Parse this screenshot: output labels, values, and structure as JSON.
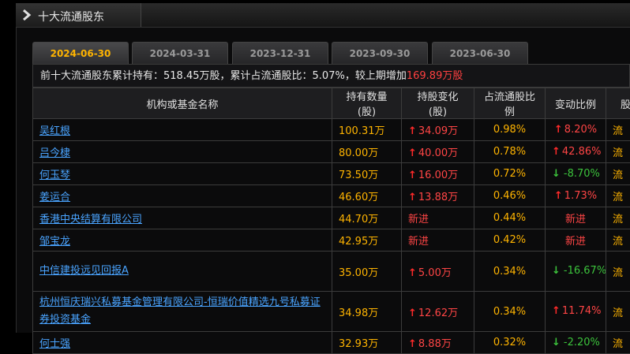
{
  "header": {
    "title": "十大流通股东"
  },
  "tabs": [
    "2024-06-30",
    "2024-03-31",
    "2023-12-31",
    "2023-09-30",
    "2023-06-30"
  ],
  "summary": {
    "prefix": "前十大流通股东累计持有：",
    "hold_value": "518.45万股",
    "mid": "，累计占流通股比：",
    "ratio_value": "5.07%",
    "suffix": "，较上期增加",
    "increase_value": "169.89万股"
  },
  "columns": [
    "机构或基金名称",
    "持有数量(股)",
    "持股变化(股)",
    "占流通股比例",
    "变动比例",
    "股"
  ],
  "rows": [
    {
      "name": "吴红根",
      "qty": "100.31万",
      "change": "34.09万",
      "change_dir": "up",
      "ratio": "0.98%",
      "var": "8.20%",
      "var_dir": "up",
      "type": "流"
    },
    {
      "name": "吕今棣",
      "qty": "80.00万",
      "change": "40.00万",
      "change_dir": "up",
      "ratio": "0.78%",
      "var": "42.86%",
      "var_dir": "up",
      "type": "流"
    },
    {
      "name": "何玉琴",
      "qty": "73.50万",
      "change": "16.00万",
      "change_dir": "up",
      "ratio": "0.72%",
      "var": "-8.70%",
      "var_dir": "down",
      "type": "流"
    },
    {
      "name": "姜运合",
      "qty": "46.60万",
      "change": "13.88万",
      "change_dir": "up",
      "ratio": "0.46%",
      "var": "1.73%",
      "var_dir": "up",
      "type": "流"
    },
    {
      "name": "香港中央结算有限公司",
      "qty": "44.70万",
      "change": "新进",
      "change_dir": "new",
      "ratio": "0.44%",
      "var": "新进",
      "var_dir": "new",
      "type": "流"
    },
    {
      "name": "邹宝龙",
      "qty": "42.95万",
      "change": "新进",
      "change_dir": "new",
      "ratio": "0.42%",
      "var": "新进",
      "var_dir": "new",
      "type": "流"
    },
    {
      "name": "中信建投远见回报A",
      "qty": "35.00万",
      "change": "5.00万",
      "change_dir": "up",
      "ratio": "0.34%",
      "var": "-16.67%",
      "var_dir": "down",
      "type": "流",
      "tall": true
    },
    {
      "name": "杭州恒庆瑞兴私募基金管理有限公司-恒瑞价值精选九号私募证券投资基金",
      "qty": "34.98万",
      "change": "12.62万",
      "change_dir": "up",
      "ratio": "0.34%",
      "var": "11.74%",
      "var_dir": "up",
      "type": "流",
      "tall": true
    },
    {
      "name": "何士强",
      "qty": "32.93万",
      "change": "8.88万",
      "change_dir": "up",
      "ratio": "0.32%",
      "var": "-2.20%",
      "var_dir": "down",
      "type": "流"
    }
  ],
  "colors": {
    "accent": "#ffb400",
    "up": "#ff4545",
    "down": "#3cc43c",
    "link": "#4aa4ff"
  }
}
